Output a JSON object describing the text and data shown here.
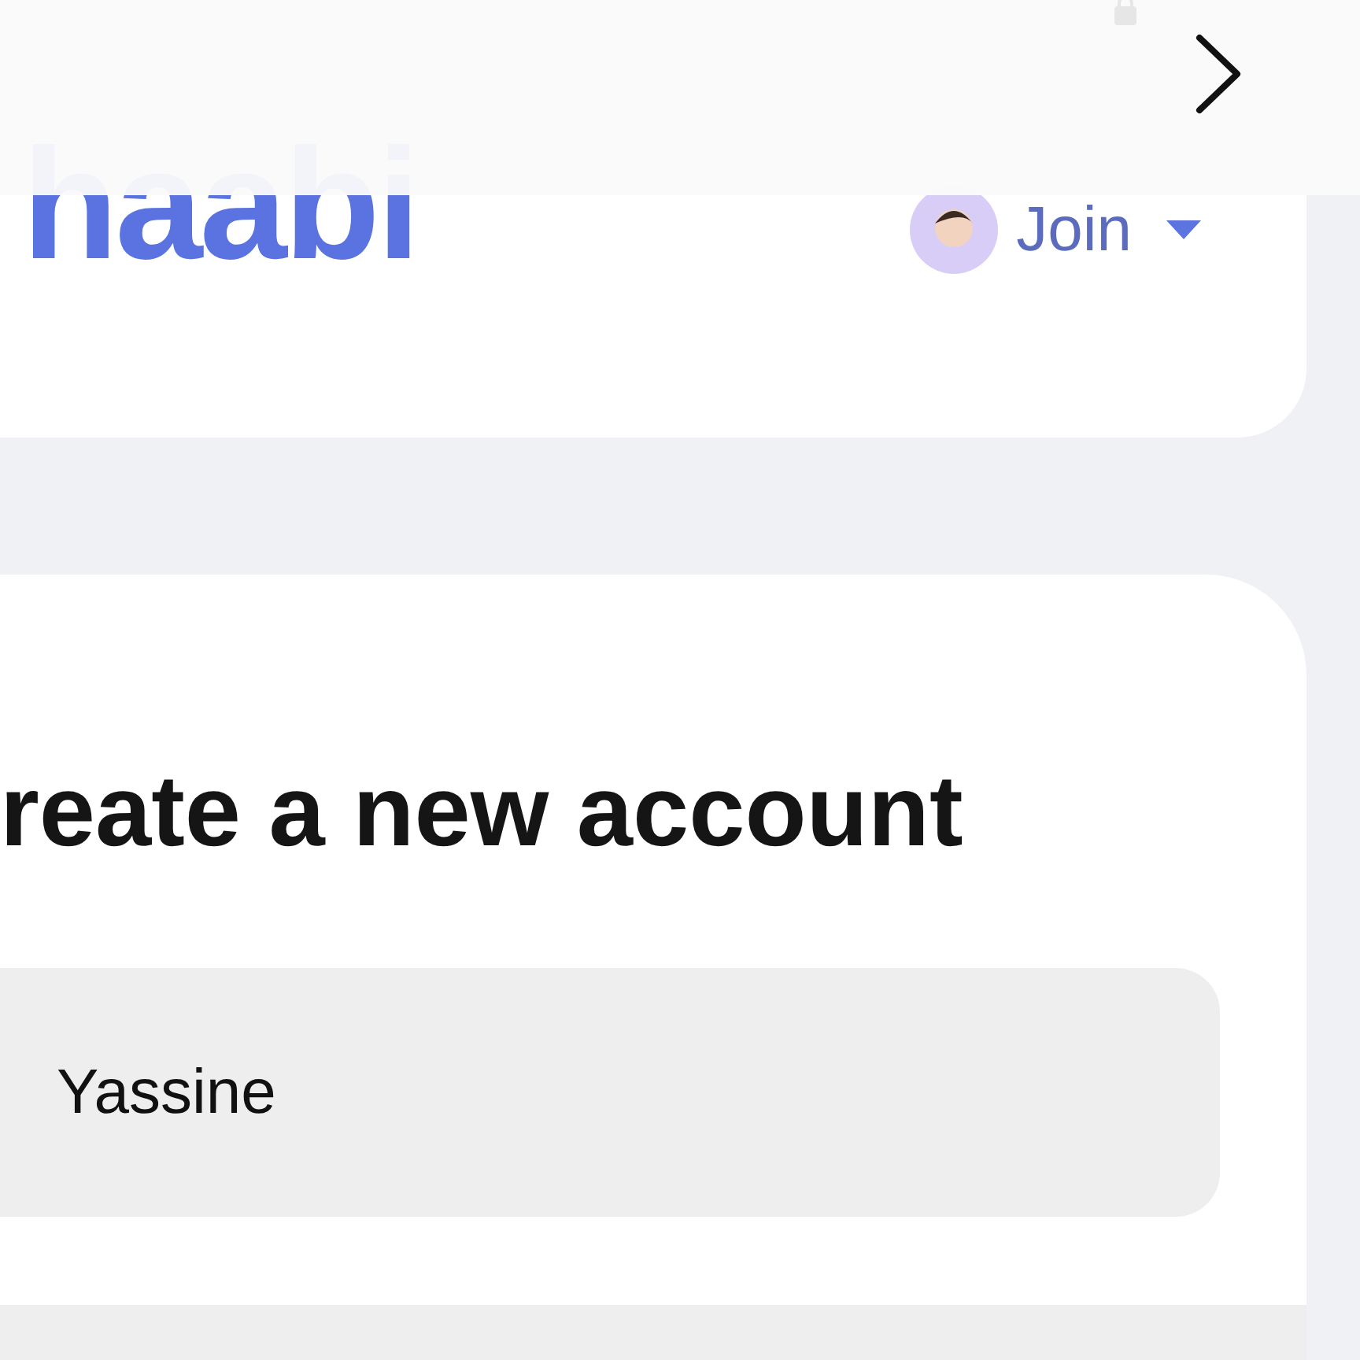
{
  "header": {
    "logo": "haabi",
    "join": {
      "label": "Join"
    }
  },
  "form": {
    "title": "reate a new account",
    "fields": [
      {
        "value": "Yassine"
      }
    ]
  }
}
